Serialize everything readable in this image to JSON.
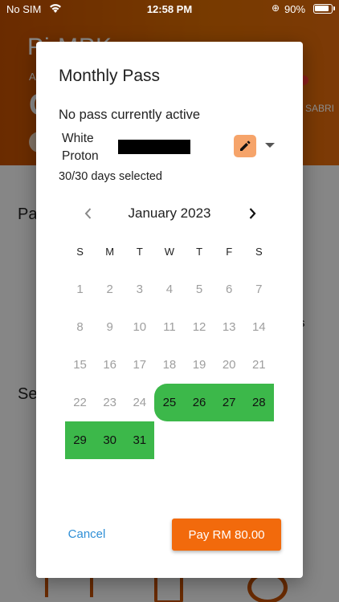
{
  "status_bar": {
    "carrier": "No SIM",
    "time": "12:58 PM",
    "battery": "90%"
  },
  "background": {
    "title": "P",
    "title_tail": "i    MPK",
    "sub": "A",
    "big": "C",
    "right_text": "SABRI",
    "section1": "Pa",
    "section2": "Se",
    "side_letter": "s"
  },
  "dialog": {
    "title": "Monthly Pass",
    "pass_status": "No pass currently active",
    "vehicle_name": "White Proton",
    "days_selected": "30/30 days selected",
    "month_label": "January 2023",
    "weekdays": [
      "S",
      "M",
      "T",
      "W",
      "T",
      "F",
      "S"
    ],
    "weeks": [
      [
        {
          "d": "1",
          "s": false
        },
        {
          "d": "2",
          "s": false
        },
        {
          "d": "3",
          "s": false
        },
        {
          "d": "4",
          "s": false
        },
        {
          "d": "5",
          "s": false
        },
        {
          "d": "6",
          "s": false
        },
        {
          "d": "7",
          "s": false
        }
      ],
      [
        {
          "d": "8",
          "s": false
        },
        {
          "d": "9",
          "s": false
        },
        {
          "d": "10",
          "s": false
        },
        {
          "d": "11",
          "s": false
        },
        {
          "d": "12",
          "s": false
        },
        {
          "d": "13",
          "s": false
        },
        {
          "d": "14",
          "s": false
        }
      ],
      [
        {
          "d": "15",
          "s": false
        },
        {
          "d": "16",
          "s": false
        },
        {
          "d": "17",
          "s": false
        },
        {
          "d": "18",
          "s": false
        },
        {
          "d": "19",
          "s": false
        },
        {
          "d": "20",
          "s": false
        },
        {
          "d": "21",
          "s": false
        }
      ],
      [
        {
          "d": "22",
          "s": false
        },
        {
          "d": "23",
          "s": false
        },
        {
          "d": "24",
          "s": false
        },
        {
          "d": "25",
          "s": true
        },
        {
          "d": "26",
          "s": true
        },
        {
          "d": "27",
          "s": true
        },
        {
          "d": "28",
          "s": true
        }
      ],
      [
        {
          "d": "29",
          "s": true
        },
        {
          "d": "30",
          "s": true
        },
        {
          "d": "31",
          "s": true
        }
      ]
    ],
    "cancel_label": "Cancel",
    "pay_label": "Pay RM 80.00"
  },
  "colors": {
    "selected": "#3cb84a",
    "accent": "#f26a0c",
    "link": "#2f8fd6",
    "edit_bg": "#f6a46a"
  },
  "icons": {
    "prev": "chevron-left-icon",
    "next": "chevron-right-icon",
    "edit": "pencil-icon",
    "dropdown": "caret-down-icon"
  }
}
